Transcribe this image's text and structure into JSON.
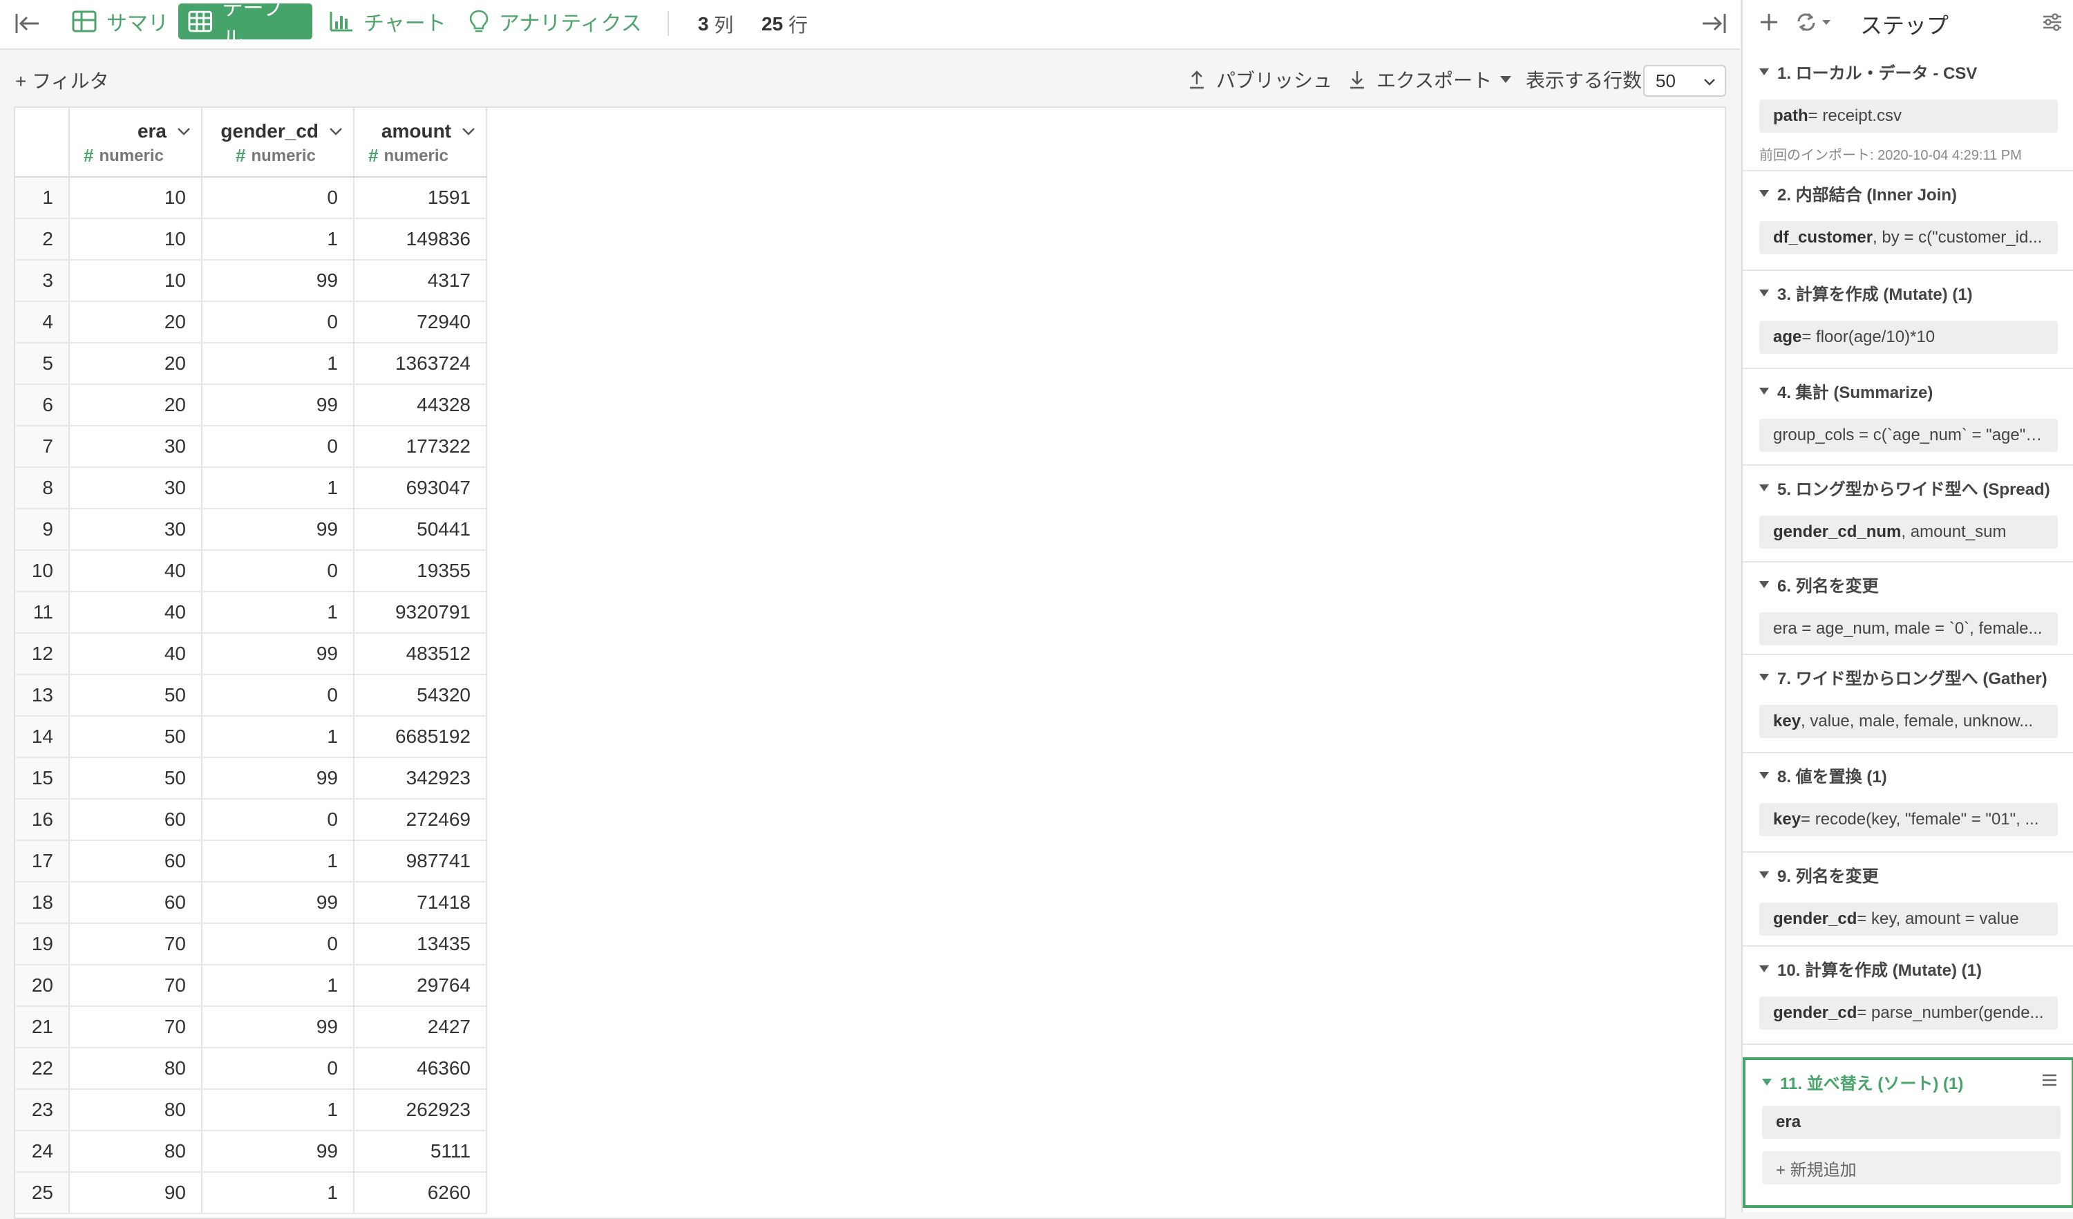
{
  "tabs": [
    {
      "label": "サマリ",
      "icon": "summary-grid-icon"
    },
    {
      "label": "テーブル",
      "icon": "table-icon"
    },
    {
      "label": "チャート",
      "icon": "chart-bar-icon"
    },
    {
      "label": "アナリティクス",
      "icon": "lightbulb-icon"
    }
  ],
  "counts": {
    "cols": "3",
    "cols_unit": "列",
    "rows": "25",
    "rows_unit": "行"
  },
  "toolbar": {
    "filter_label": "+ フィルタ",
    "publish_label": "パブリッシュ",
    "export_label": "エクスポート",
    "rows_label": "表示する行数",
    "rows_value": "50"
  },
  "table": {
    "columns": [
      {
        "name": "era",
        "type": "numeric"
      },
      {
        "name": "gender_cd",
        "type": "numeric"
      },
      {
        "name": "amount",
        "type": "numeric"
      }
    ],
    "type_symbol": "#",
    "rows": [
      [
        "1",
        "10",
        "0",
        "1591"
      ],
      [
        "2",
        "10",
        "1",
        "149836"
      ],
      [
        "3",
        "10",
        "99",
        "4317"
      ],
      [
        "4",
        "20",
        "0",
        "72940"
      ],
      [
        "5",
        "20",
        "1",
        "1363724"
      ],
      [
        "6",
        "20",
        "99",
        "44328"
      ],
      [
        "7",
        "30",
        "0",
        "177322"
      ],
      [
        "8",
        "30",
        "1",
        "693047"
      ],
      [
        "9",
        "30",
        "99",
        "50441"
      ],
      [
        "10",
        "40",
        "0",
        "19355"
      ],
      [
        "11",
        "40",
        "1",
        "9320791"
      ],
      [
        "12",
        "40",
        "99",
        "483512"
      ],
      [
        "13",
        "50",
        "0",
        "54320"
      ],
      [
        "14",
        "50",
        "1",
        "6685192"
      ],
      [
        "15",
        "50",
        "99",
        "342923"
      ],
      [
        "16",
        "60",
        "0",
        "272469"
      ],
      [
        "17",
        "60",
        "1",
        "987741"
      ],
      [
        "18",
        "60",
        "99",
        "71418"
      ],
      [
        "19",
        "70",
        "0",
        "13435"
      ],
      [
        "20",
        "70",
        "1",
        "29764"
      ],
      [
        "21",
        "70",
        "99",
        "2427"
      ],
      [
        "22",
        "80",
        "0",
        "46360"
      ],
      [
        "23",
        "80",
        "1",
        "262923"
      ],
      [
        "24",
        "80",
        "99",
        "5111"
      ],
      [
        "25",
        "90",
        "1",
        "6260"
      ]
    ]
  },
  "steps_panel": {
    "title": "ステップ",
    "steps": [
      {
        "title": "1. ローカル・データ - CSV",
        "bold": "path",
        "rest": " = receipt.csv",
        "note": "前回のインポート: 2020-10-04 4:29:11 PM"
      },
      {
        "title": "2. 内部結合 (Inner Join)",
        "bold": "df_customer",
        "rest": ", by = c(\"customer_id..."
      },
      {
        "title": "3. 計算を作成 (Mutate) (1)",
        "bold": "age",
        "rest": " = floor(age/10)*10"
      },
      {
        "title": "4. 集計 (Summarize)",
        "bold": "",
        "rest": "group_cols = c(`age_num` = \"age\", `..."
      },
      {
        "title": "5. ロング型からワイド型へ (Spread)",
        "bold": "gender_cd_num",
        "rest": ", amount_sum"
      },
      {
        "title": "6. 列名を変更",
        "bold": "",
        "rest": "era = age_num, male = `0`, female..."
      },
      {
        "title": "7. ワイド型からロング型へ (Gather)",
        "bold": "key",
        "rest": ", value, male, female, unknow..."
      },
      {
        "title": "8. 値を置換 (1)",
        "bold": "key",
        "rest": " = recode(key, \"female\" = \"01\", ..."
      },
      {
        "title": "9. 列名を変更",
        "bold": "gender_cd",
        "rest": " = key, amount = value"
      },
      {
        "title": "10. 計算を作成 (Mutate) (1)",
        "bold": "gender_cd",
        "rest": " = parse_number(gende..."
      },
      {
        "title": "11. 並べ替え (ソート) (1)",
        "bold": "era",
        "rest": "",
        "add_label": "+ 新規追加"
      }
    ]
  },
  "colors": {
    "accent": "#46a46a",
    "background": "#f5f5f5"
  }
}
